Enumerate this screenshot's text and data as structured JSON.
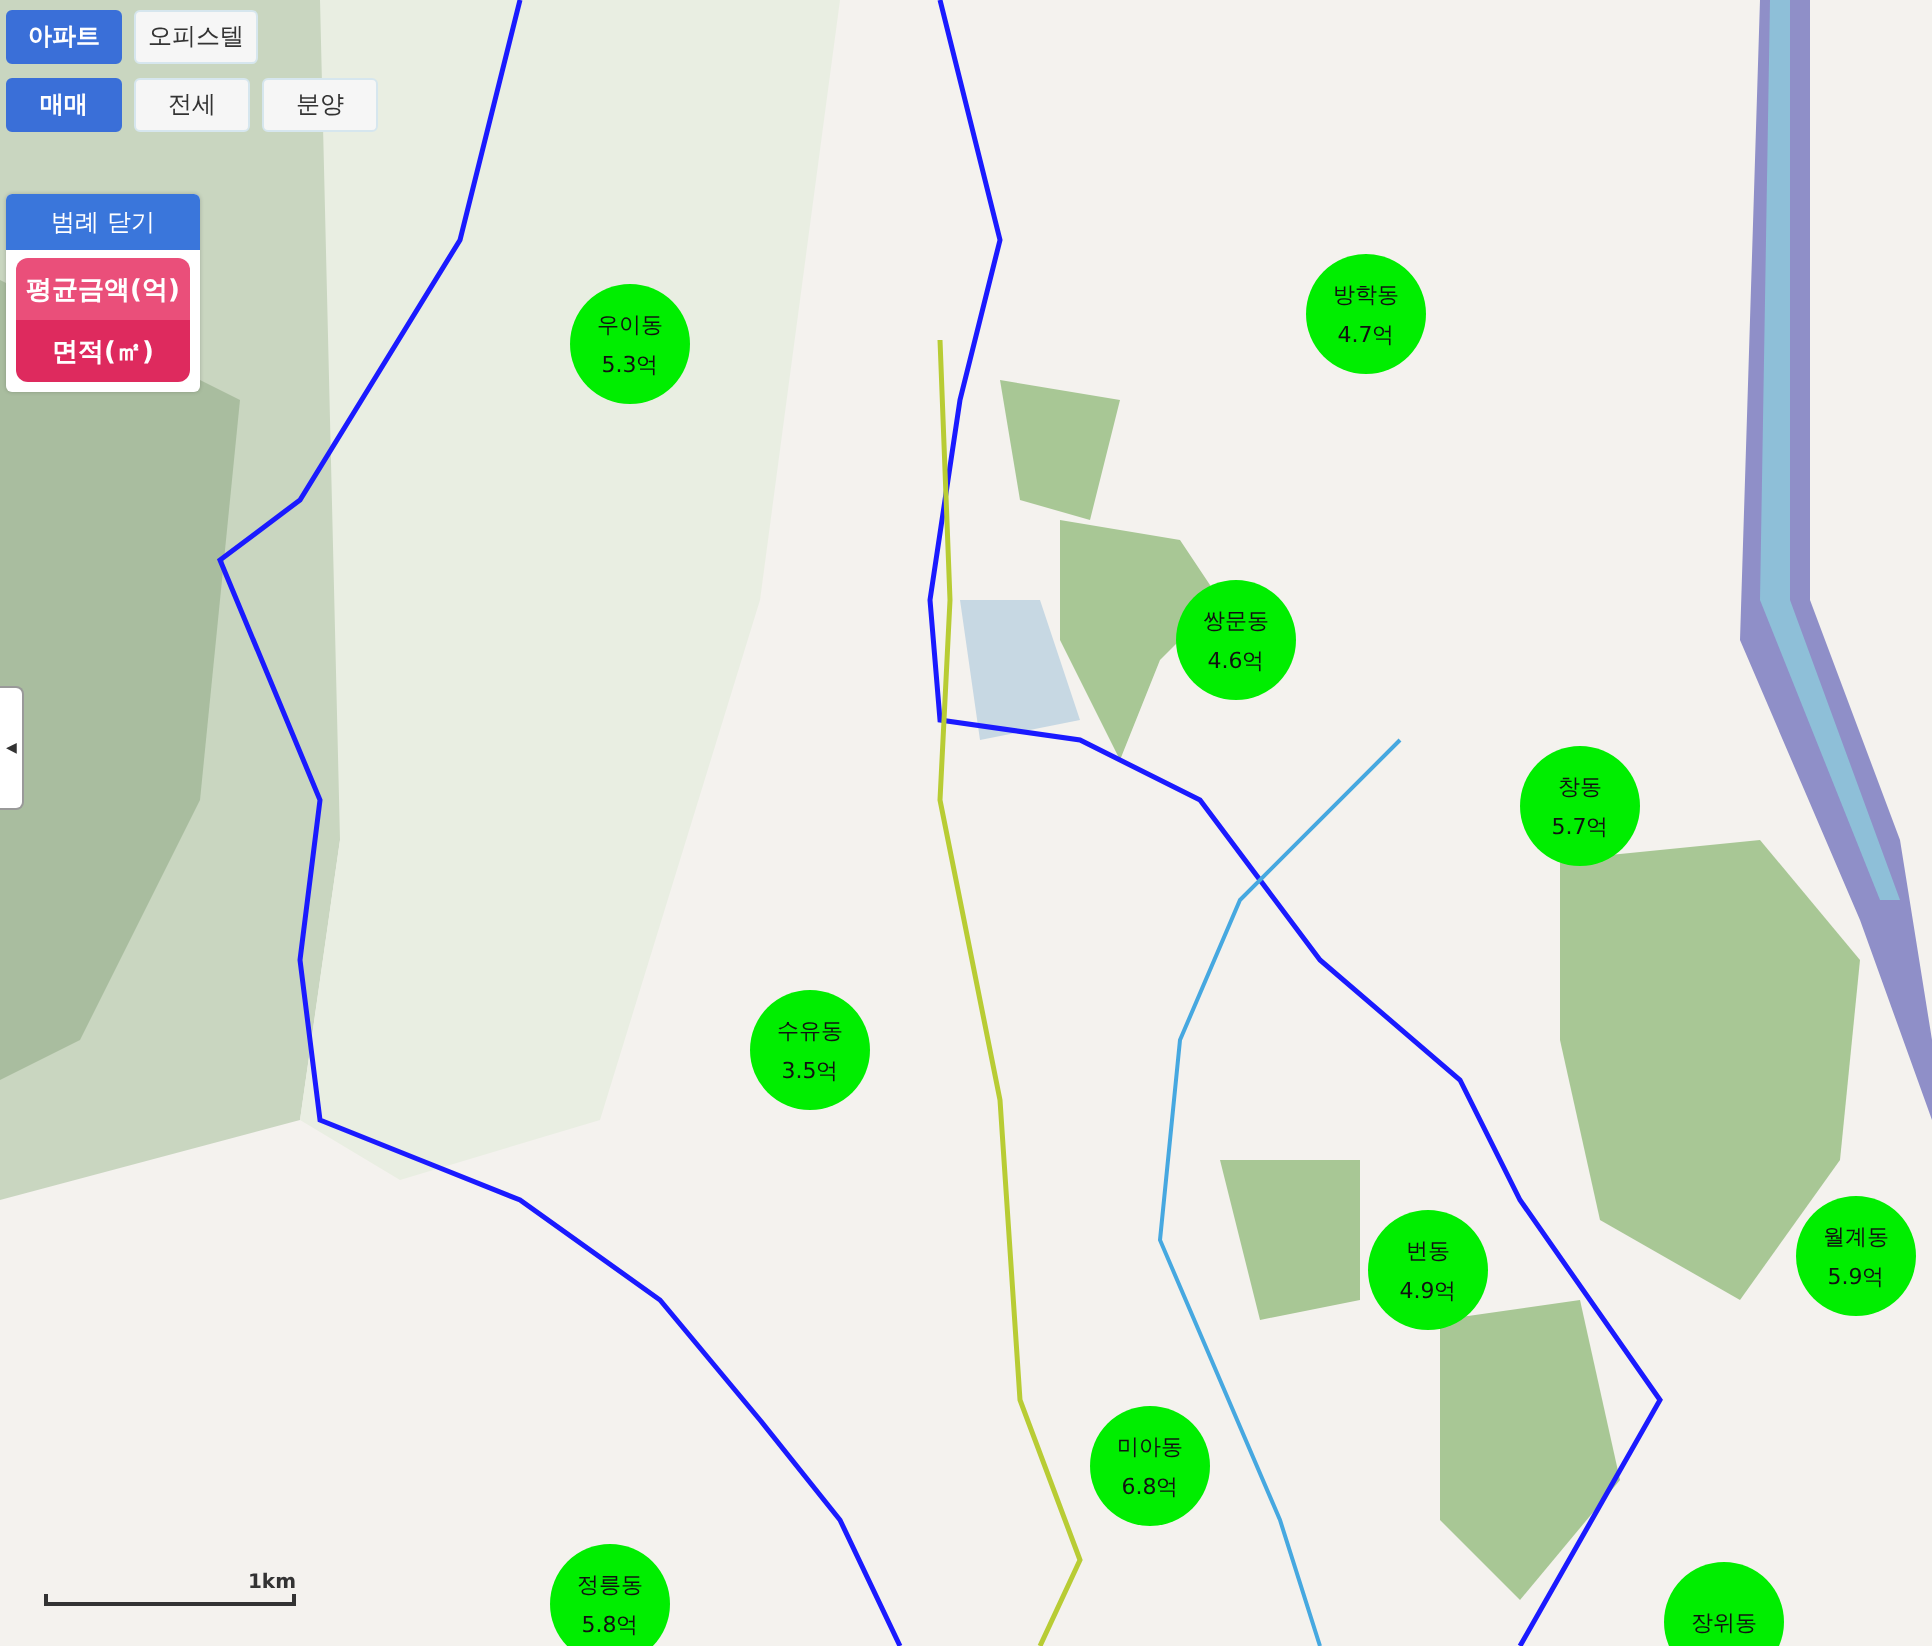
{
  "property_types": [
    {
      "label": "아파트",
      "selected": true
    },
    {
      "label": "오피스텔",
      "selected": false
    }
  ],
  "deal_types": [
    {
      "label": "매매",
      "selected": true
    },
    {
      "label": "전세",
      "selected": false
    },
    {
      "label": "분양",
      "selected": false
    }
  ],
  "legend": {
    "toggle": "범례 닫기",
    "items": [
      "평균금액(억)",
      "면적(㎡)"
    ]
  },
  "side_handle": "◀",
  "markers": [
    {
      "name": "우이동",
      "price": "5.3억"
    },
    {
      "name": "방학동",
      "price": "4.7억"
    },
    {
      "name": "쌍문동",
      "price": "4.6억"
    },
    {
      "name": "창동",
      "price": "5.7억"
    },
    {
      "name": "수유동",
      "price": "3.5억"
    },
    {
      "name": "번동",
      "price": "4.9억"
    },
    {
      "name": "월계동",
      "price": "5.9억"
    },
    {
      "name": "미아동",
      "price": "6.8억"
    },
    {
      "name": "정릉동",
      "price": "5.8억"
    },
    {
      "name": "장위동"
    }
  ],
  "scale": "1km"
}
